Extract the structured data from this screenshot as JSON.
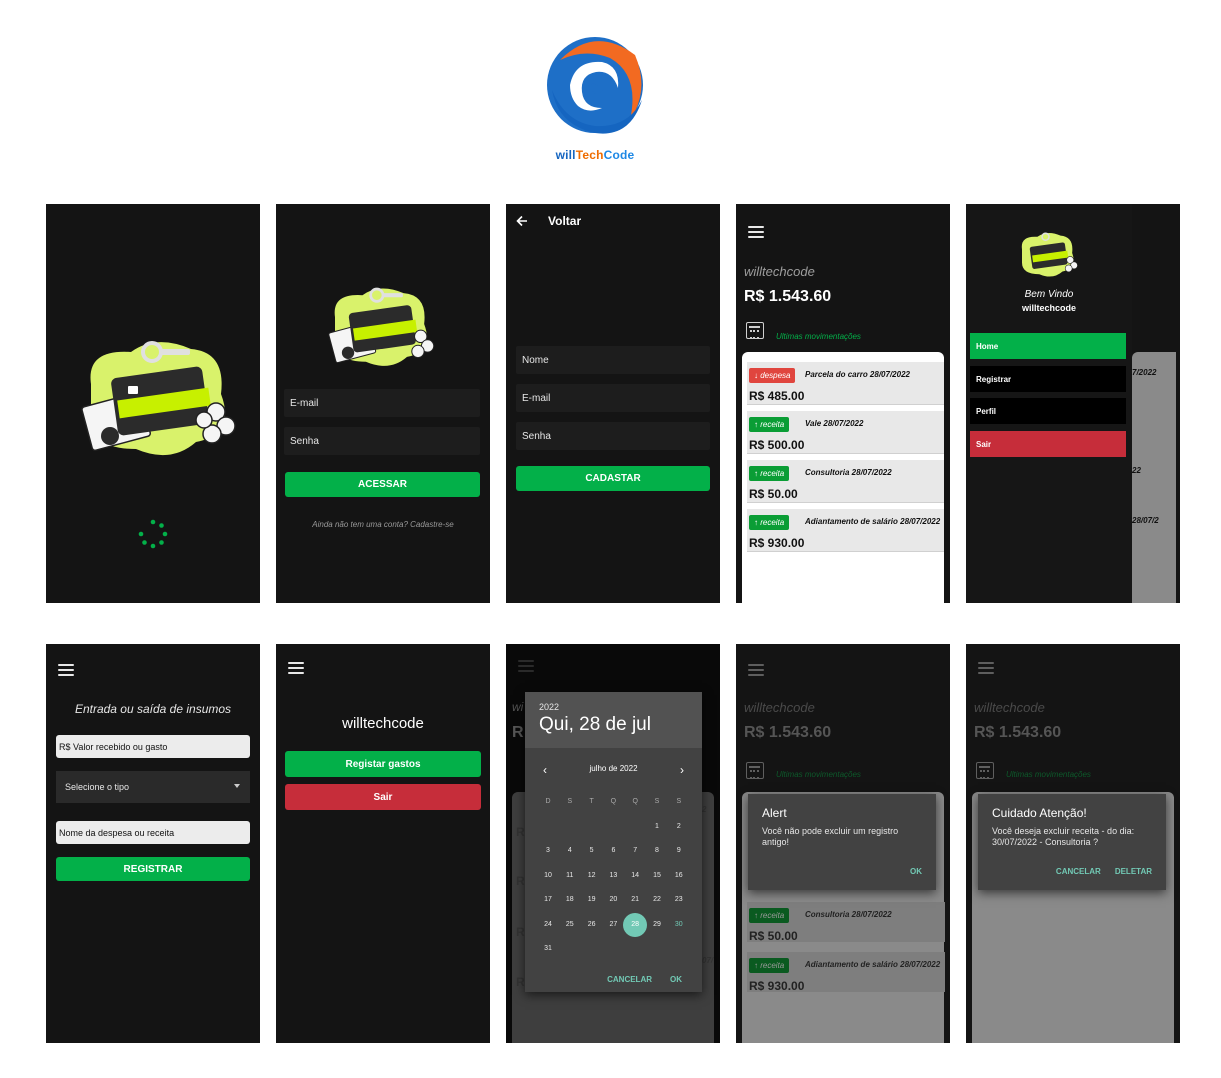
{
  "brand": {
    "will": "will",
    "tech": "Tech",
    "code": "Code"
  },
  "splash": {},
  "login": {
    "email_label": "E-mail",
    "password_label": "Senha",
    "submit_label": "ACESSAR",
    "signup_prompt": "Ainda não tem uma conta? Cadastre-se"
  },
  "register": {
    "back_label": "Voltar",
    "name_label": "Nome",
    "email_label": "E-mail",
    "password_label": "Senha",
    "submit_label": "CADASTAR"
  },
  "dashboard": {
    "user": "willtechcode",
    "balance": "R$ 1.543.60",
    "last_movements": "Ultimas movimentações",
    "items": [
      {
        "type": "despesa",
        "desc": "Parcela do carro   28/07/2022",
        "value": "R$ 485.00"
      },
      {
        "type": "receita",
        "desc": "Vale   28/07/2022",
        "value": "R$ 500.00"
      },
      {
        "type": "receita",
        "desc": "Consultoria   28/07/2022",
        "value": "R$ 50.00"
      },
      {
        "type": "receita",
        "desc": "Adiantamento de salário   28/07/2022",
        "value": "R$ 930.00"
      }
    ]
  },
  "drawer": {
    "welcome": "Bem Vindo",
    "user": "willtechcode",
    "items": [
      "Home",
      "Registrar",
      "Perfil",
      "Sair"
    ],
    "peek": [
      "7/2022",
      "22",
      "28/07/2"
    ]
  },
  "entry": {
    "title": "Entrada ou saída de insumos",
    "value_placeholder": "R$ Valor recebido ou gasto",
    "type_placeholder": "Selecione o tipo",
    "name_placeholder": "Nome da despesa ou receita",
    "submit_label": "REGISTRAR"
  },
  "profile": {
    "user": "willtechcode",
    "expenses_label": "Registar gastos",
    "logout_label": "Sair"
  },
  "datepicker": {
    "year": "2022",
    "date": "Qui, 28 de jul",
    "month": "julho de 2022",
    "weekdays": [
      "D",
      "S",
      "T",
      "Q",
      "Q",
      "S",
      "S"
    ],
    "cancel": "CANCELAR",
    "ok": "OK",
    "peek_letters": [
      "wi",
      "R",
      "R",
      "R",
      "R",
      "R"
    ],
    "peek_dates": [
      "2",
      "07/"
    ]
  },
  "alert": {
    "title": "Alert",
    "body": "Você não pode excluir um registro antigo!",
    "ok": "OK"
  },
  "confirm": {
    "title": "Cuidado Atenção!",
    "body": "Você deseja excluir receita - do dia: 30/07/2022 - Consultoria  ?",
    "cancel": "CANCELAR",
    "delete": "DELETAR"
  },
  "colors": {
    "green": "#03b049",
    "red": "#c62d3a",
    "teal": "#72c9b5",
    "background": "#141414"
  }
}
